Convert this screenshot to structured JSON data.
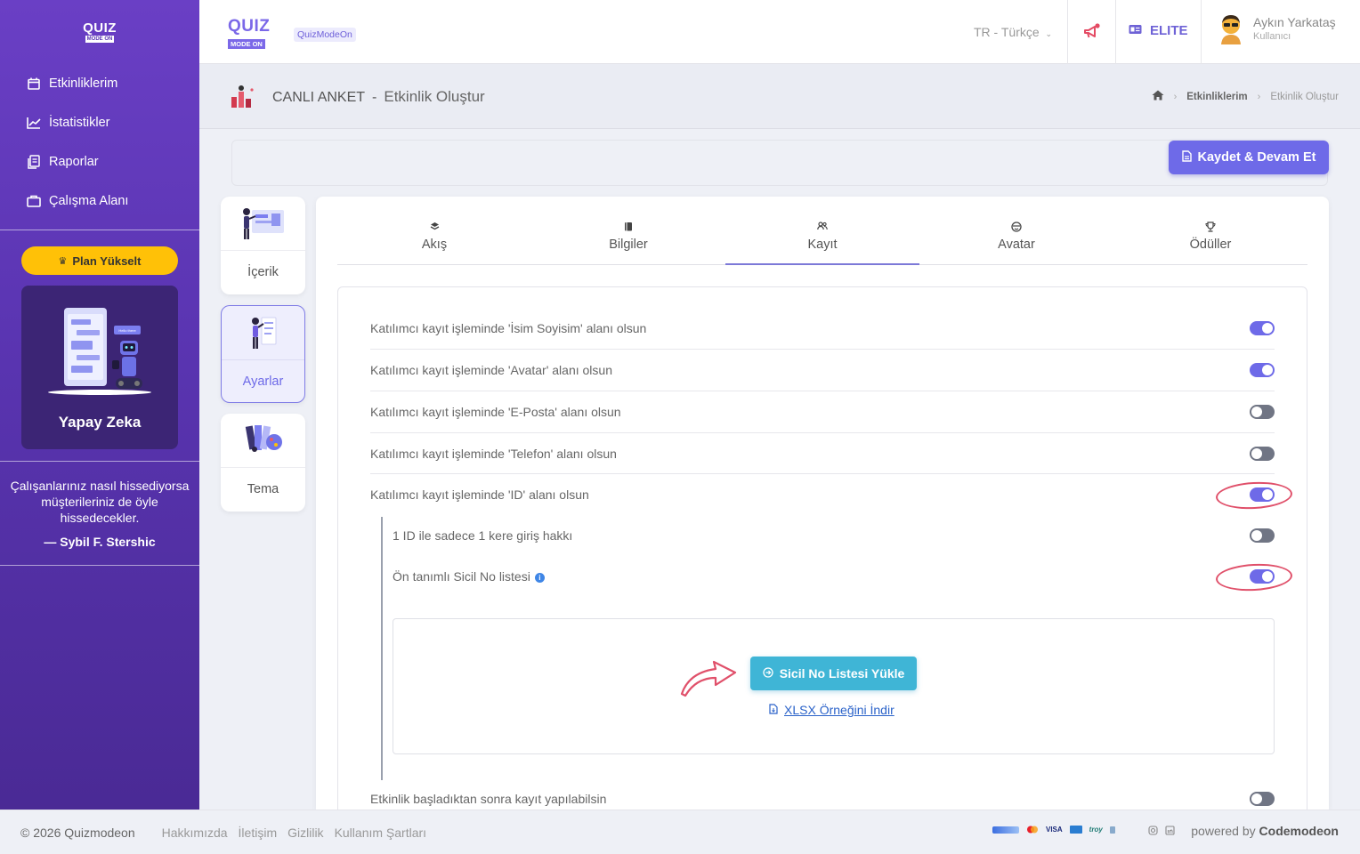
{
  "sidebar": {
    "logo_top": "QUIZ",
    "logo_bottom": "MODE ON",
    "items": [
      {
        "label": "Etkinliklerim",
        "icon": "calendar-icon"
      },
      {
        "label": "İstatistikler",
        "icon": "chart-line-icon"
      },
      {
        "label": "Raporlar",
        "icon": "report-icon"
      },
      {
        "label": "Çalışma Alanı",
        "icon": "briefcase-icon"
      }
    ],
    "plan_button": "Plan Yükselt",
    "ai_card_label": "Yapay Zeka",
    "ai_card_bubble": "Hello there",
    "quote": "Çalışanlarınız nasıl hissediyorsa müşterileriniz de öyle hissedecekler.",
    "quote_author": "— Sybil F. Stershic"
  },
  "header": {
    "logo_top": "QUIZ",
    "logo_bottom": "MODE ON",
    "tag": "QuizModeOn",
    "language": "TR - Türkçe",
    "plan": "ELITE",
    "user_name": "Aykın Yarkataş",
    "user_role": "Kullanıcı"
  },
  "page": {
    "category": "CANLI ANKET",
    "separator": "-",
    "title": "Etkinlik Oluştur",
    "breadcrumb": [
      "Etkinliklerim",
      "Etkinlik Oluştur"
    ],
    "save_button": "Kaydet & Devam Et"
  },
  "steps": [
    {
      "label": "İçerik",
      "active": false
    },
    {
      "label": "Ayarlar",
      "active": true
    },
    {
      "label": "Tema",
      "active": false
    }
  ],
  "tabs": [
    {
      "label": "Akış",
      "icon": "layers-icon",
      "active": false
    },
    {
      "label": "Bilgiler",
      "icon": "book-icon",
      "active": false
    },
    {
      "label": "Kayıt",
      "icon": "users-icon",
      "active": true
    },
    {
      "label": "Avatar",
      "icon": "face-icon",
      "active": false
    },
    {
      "label": "Ödüller",
      "icon": "trophy-icon",
      "active": false
    }
  ],
  "settings": [
    {
      "label": "Katılımcı kayıt işleminde 'İsim Soyisim' alanı olsun",
      "on": true
    },
    {
      "label": "Katılımcı kayıt işleminde 'Avatar' alanı olsun",
      "on": true
    },
    {
      "label": "Katılımcı kayıt işleminde 'E-Posta' alanı olsun",
      "on": false
    },
    {
      "label": "Katılımcı kayıt işleminde 'Telefon' alanı olsun",
      "on": false
    },
    {
      "label": "Katılımcı kayıt işleminde 'ID' alanı olsun",
      "on": true
    }
  ],
  "sub_settings": [
    {
      "label": "1 ID ile sadece 1 kere giriş hakkı",
      "on": false
    },
    {
      "label": "Ön tanımlı Sicil No listesi",
      "on": true
    }
  ],
  "upload": {
    "button": "Sicil No Listesi Yükle",
    "link": "XLSX Örneğini İndir"
  },
  "last_setting": {
    "label": "Etkinlik başladıktan sonra kayıt yapılabilsin",
    "on": false
  },
  "footer": {
    "copyright": "© 2026 Quizmodeon",
    "links": [
      "Hakkımızda",
      "İletişim",
      "Gizlilik",
      "Kullanım Şartları"
    ],
    "payments": [
      "VISA",
      "troy"
    ],
    "powered_prefix": "powered by",
    "powered_brand": "Codemodeon"
  },
  "colors": {
    "sidebar": "#5934b0",
    "accent": "#6e6ae8",
    "plan_button": "#ffc107",
    "upload_button": "#3fb5d6",
    "annotation": "#e0506a"
  }
}
